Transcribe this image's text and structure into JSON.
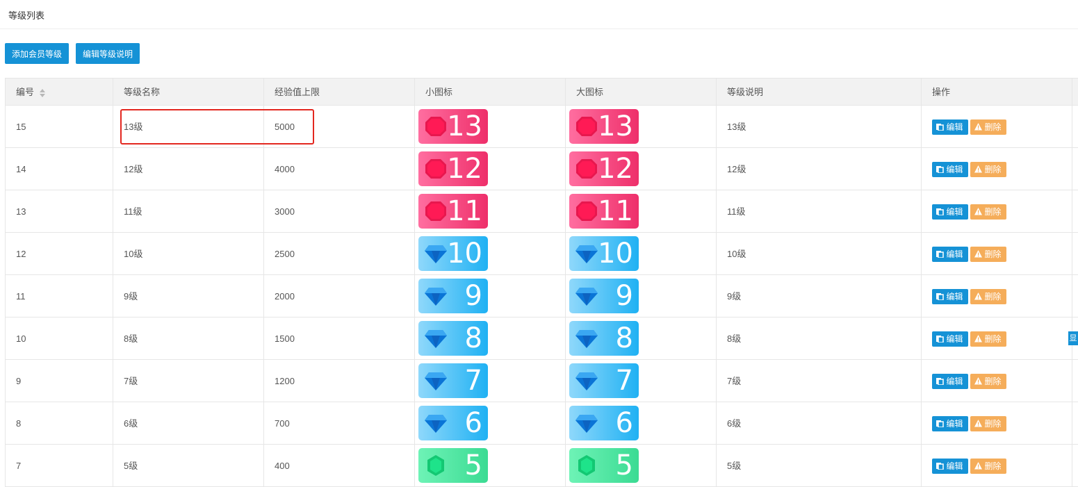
{
  "page": {
    "title": "等级列表"
  },
  "toolbar": {
    "add_label": "添加会员等级",
    "edit_desc_label": "编辑等级说明"
  },
  "table": {
    "headers": [
      "编号",
      "等级名称",
      "经验值上限",
      "小图标",
      "大图标",
      "等级说明",
      "操作"
    ],
    "rows": [
      {
        "id": "15",
        "name": "13级",
        "exp": "5000",
        "icon_num": "13",
        "icon_type": "red",
        "desc": "13级"
      },
      {
        "id": "14",
        "name": "12级",
        "exp": "4000",
        "icon_num": "12",
        "icon_type": "red",
        "desc": "12级"
      },
      {
        "id": "13",
        "name": "11级",
        "exp": "3000",
        "icon_num": "11",
        "icon_type": "red",
        "desc": "11级"
      },
      {
        "id": "12",
        "name": "10级",
        "exp": "2500",
        "icon_num": "10",
        "icon_type": "blue",
        "desc": "10级"
      },
      {
        "id": "11",
        "name": "9级",
        "exp": "2000",
        "icon_num": "9",
        "icon_type": "blue",
        "desc": "9级"
      },
      {
        "id": "10",
        "name": "8级",
        "exp": "1500",
        "icon_num": "8",
        "icon_type": "blue",
        "desc": "8级"
      },
      {
        "id": "9",
        "name": "7级",
        "exp": "1200",
        "icon_num": "7",
        "icon_type": "blue",
        "desc": "7级"
      },
      {
        "id": "8",
        "name": "6级",
        "exp": "700",
        "icon_num": "6",
        "icon_type": "blue",
        "desc": "6级"
      },
      {
        "id": "7",
        "name": "5级",
        "exp": "400",
        "icon_num": "5",
        "icon_type": "green",
        "desc": "5级"
      }
    ],
    "actions": {
      "edit": "编辑",
      "delete": "删除"
    }
  },
  "side_tab": {
    "label": "显"
  },
  "colors": {
    "primary": "#1592d6",
    "warning": "#f5ad5a",
    "highlight": "#e3271f"
  },
  "icons": {
    "sort": "sort-icon",
    "edit": "edit-icon",
    "delete": "warning-icon",
    "gem_red": "octagon-gem-icon",
    "gem_blue": "diamond-gem-icon",
    "gem_green": "hexagon-gem-icon"
  }
}
